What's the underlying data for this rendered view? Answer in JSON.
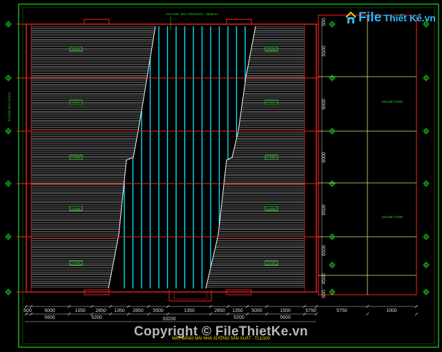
{
  "watermark": {
    "brand_prefix": "File",
    "brand_rest": "Thiết Kế.vn",
    "copyright": "Copyright © FileThietKe.vn"
  },
  "drawing": {
    "title": "MẶT BẰNG MÁI NHÀ XƯỞNG SẢN XUẤT - TL1/100",
    "top_note": "GHI CHÚ: MÁI TÔN/VÁCH - 4500mm",
    "left_note": "TƯỜNG BAO GẠCH",
    "left_slope_tags": [
      "i=10%",
      "i=10%",
      "i=10%",
      "i=10%",
      "i=10%"
    ],
    "right_slope_tags": [
      "i=10%",
      "i=10%",
      "i=10%",
      "i=10%",
      "i=10%"
    ],
    "annex_labels": [
      "SÂN BÊ TÔNG",
      "SÂN BÊ TÔNG"
    ],
    "right_dims": [
      "500",
      "6500",
      "6000",
      "6000",
      "6500",
      "6500",
      "4500",
      "600"
    ],
    "bottom_dims_row1": [
      "600",
      "5000",
      "1350",
      "2850",
      "1350",
      "2850",
      "5500",
      "1350",
      "2850",
      "1350",
      "5000",
      "1500",
      "5750",
      "5750",
      "1000"
    ],
    "bottom_dims_row2": [
      "5600",
      "5200",
      "5200",
      "5600"
    ],
    "overall_dim": "33200",
    "colors": {
      "background": "#000000",
      "roof_hatch": "#cfcfcf",
      "skylight": "#00e5ff",
      "wall": "#ff2222",
      "axis": "#1fe01f",
      "annex": "#e6e680",
      "title": "#ffe100"
    }
  }
}
